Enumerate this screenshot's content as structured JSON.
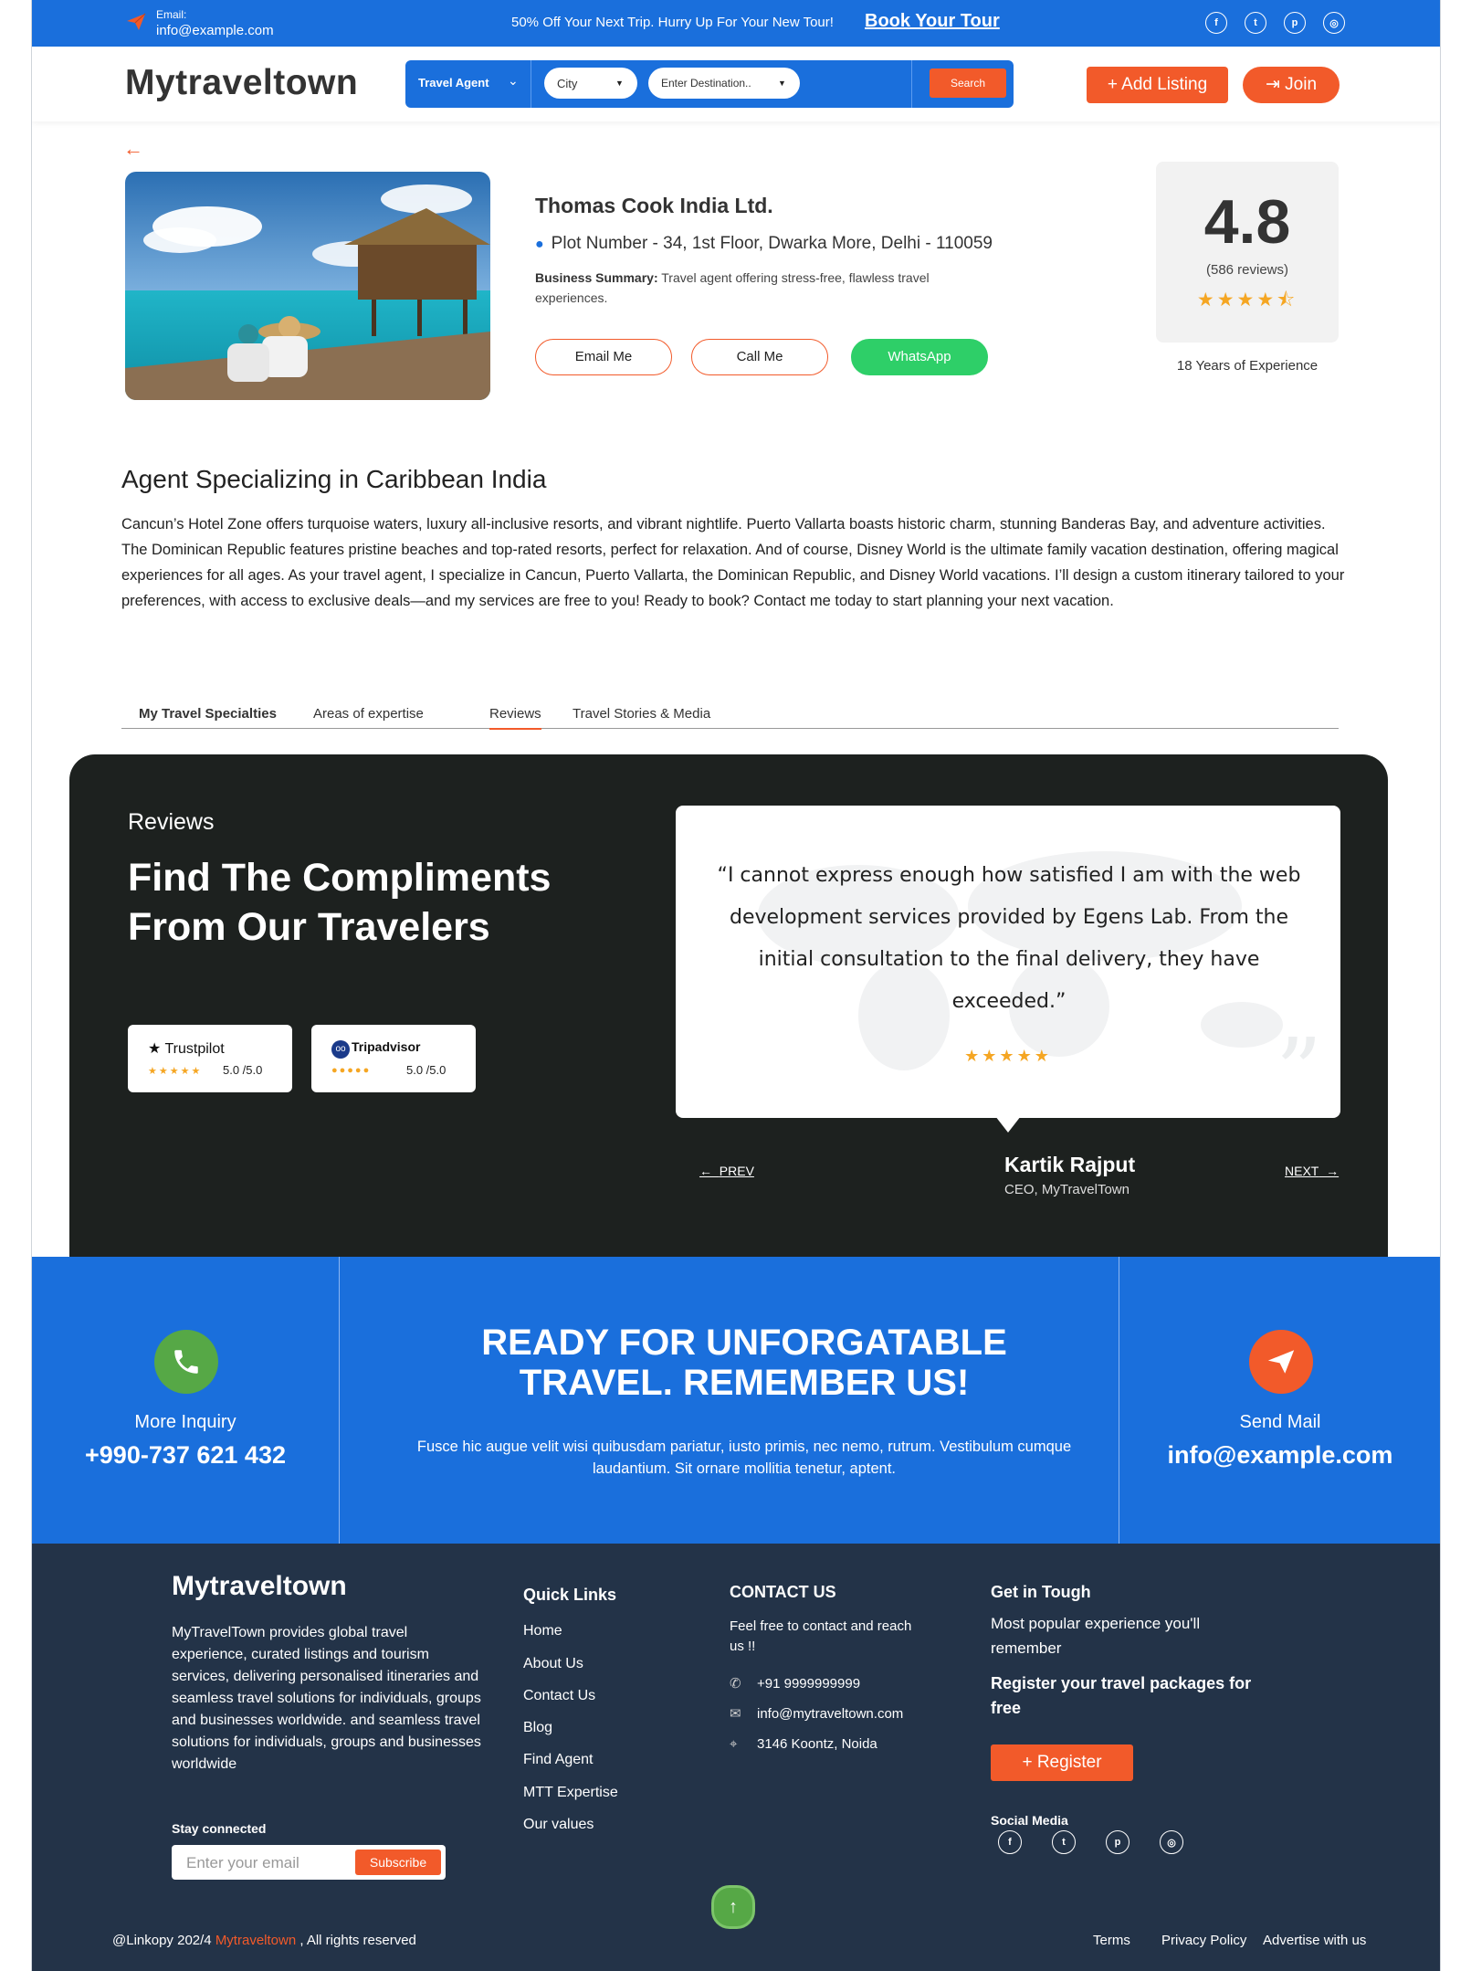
{
  "topbar": {
    "email_label": "Email:",
    "email": "info@example.com",
    "promo": "50% Off Your Next Trip. Hurry Up For Your New Tour!",
    "book_link": "Book Your Tour",
    "social": [
      "f",
      "t",
      "p",
      "ig"
    ]
  },
  "header": {
    "logo": "Mytraveltown",
    "search": {
      "category": "Travel Agent",
      "city": "City",
      "destination": "Enter Destination..",
      "button": "Search"
    },
    "add_listing": "Add Listing",
    "join": "Join"
  },
  "business": {
    "name": "Thomas Cook India Ltd.",
    "address": "Plot Number - 34, 1st Floor, Dwarka More, Delhi - 110059",
    "summary_label": "Business Summary:",
    "summary": "Travel agent offering stress-free, flawless travel experiences.",
    "buttons": {
      "email": "Email Me",
      "call": "Call Me",
      "whatsapp": "WhatsApp"
    },
    "rating": "4.8",
    "reviews": "(586 reviews)",
    "rating_value": 4.5,
    "stars": "★★★★⯪",
    "experience": "18 Years of Experience"
  },
  "specializing": {
    "title": "Agent Specializing in Caribbean India",
    "text": "Cancun’s Hotel Zone offers turquoise waters, luxury all-inclusive resorts, and vibrant nightlife. Puerto Vallarta boasts historic charm, stunning Banderas Bay, and adventure activities. The Dominican Republic features pristine beaches and top-rated resorts, perfect for relaxation. And of course, Disney World is the ultimate family vacation destination, offering magical experiences for all ages. As your travel agent, I specialize in Cancun, Puerto Vallarta, the Dominican Republic, and Disney World vacations. I’ll design a custom itinerary tailored to your preferences, with access to exclusive deals—and my services are free to you! Ready to book? Contact me today to start planning your next vacation."
  },
  "tabs": [
    {
      "label": "My Travel Specialties"
    },
    {
      "label": "Areas of expertise"
    },
    {
      "label": "Reviews"
    },
    {
      "label": "Travel Stories & Media"
    }
  ],
  "active_tab": "Reviews",
  "reviews": {
    "kicker": "Reviews",
    "title": "Find The Compliments From Our Travelers",
    "badges": [
      {
        "name": "★ Trustpilot",
        "score": "5.0 /5.0",
        "stars": "★★★★★"
      },
      {
        "name": "Tripadvisor",
        "score": "5.0 /5.0",
        "stars": "●●●●●"
      }
    ],
    "quote": "“I cannot express enough how satisfied I am with the web development services provided by Egens Lab. From the initial consultation to the final delivery, they have exceeded.”",
    "quote_stars": "★★★★★",
    "prev": "PREV",
    "next": "NEXT",
    "reviewer": "Kartik Rajput",
    "role": "CEO, MyTravelTown"
  },
  "cta": {
    "left_label": "More Inquiry",
    "phone": "+990-737 621 432",
    "headline": "READY FOR UNFORGATABLE TRAVEL. REMEMBER US!",
    "subtext": "Fusce hic augue velit wisi quibusdam pariatur, iusto primis, nec nemo, rutrum. Vestibulum cumque laudantium. Sit ornare mollitia tenetur, aptent.",
    "right_label": "Send Mail",
    "email": "info@example.com"
  },
  "footer": {
    "logo": "Mytraveltown",
    "description": "MyTravelTown provides global travel experience, curated listings and tourism services, delivering personalised itineraries and seamless travel solutions for individuals, groups and businesses worldwide.  and seamless travel solutions for individuals, groups and businesses worldwide",
    "stay_connected": "Stay connected",
    "email_placeholder": "Enter your email",
    "subscribe": "Subscribe",
    "quick_links_title": "Quick Links",
    "quick_links": [
      "Home",
      "About Us",
      "Contact Us",
      "Blog",
      "Find Agent",
      "MTT Expertise",
      "Our values"
    ],
    "contact_title": "CONTACT US",
    "contact_intro": "Feel free to contact and reach us !!",
    "contact_phone": "+91 9999999999",
    "contact_email": "info@mytraveltown.com",
    "contact_address": "3146 Koontz, Noida",
    "touch_title": "Get in Tough",
    "touch_text": "Most popular experience you'll remember",
    "touch_bold": "Register your travel packages for free",
    "register": "Register",
    "social_title": "Social Media",
    "copyright_pre": "@Linkopy 202/4 ",
    "copyright_brand": "Mytraveltown",
    "copyright_post": " , All rights reserved",
    "bottom_links": [
      "Terms",
      "Privacy Policy",
      "Advertise with us"
    ]
  },
  "colors": {
    "brand_blue": "#1a6fdc",
    "accent_orange": "#f25a2a",
    "whatsapp_green": "#2ecf68",
    "dark": "#1d211f",
    "footer": "#233348"
  },
  "icons": [
    "send-plane-icon",
    "facebook-icon",
    "twitter-icon",
    "pinterest-icon",
    "instagram-icon",
    "chevron-down-icon",
    "plus-icon",
    "login-icon",
    "back-arrow-icon",
    "map-pin-icon",
    "star-icon",
    "phone-icon",
    "mail-icon",
    "location-icon",
    "quote-icon",
    "arrow-up-icon"
  ]
}
